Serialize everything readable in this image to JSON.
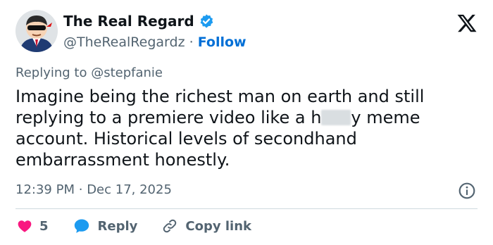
{
  "author": {
    "display_name": "The Real Regard",
    "handle": "@TheRealRegardz",
    "separator": "·",
    "follow_label": "Follow",
    "verified": true,
    "avatar_icon": "sunglasses-mascot-avatar"
  },
  "platform_icon": "x-logo-icon",
  "reply_context": {
    "prefix": "Replying to",
    "mention": "@stepfanie"
  },
  "tweet": {
    "text_before_censor": "Imagine being the richest man on earth and still replying to a premiere video like a h",
    "text_after_censor": "y meme account. Historical levels of secondhand embarrassment honestly."
  },
  "meta": {
    "time": "12:39 PM",
    "separator": "·",
    "date": "Dec 17, 2025"
  },
  "actions": {
    "like_count": "5",
    "reply_label": "Reply",
    "copy_link_label": "Copy link"
  },
  "colors": {
    "accent": "#1d9bf0",
    "like": "#f91880",
    "follow": "#006fd6",
    "secondary_text": "#536471"
  }
}
